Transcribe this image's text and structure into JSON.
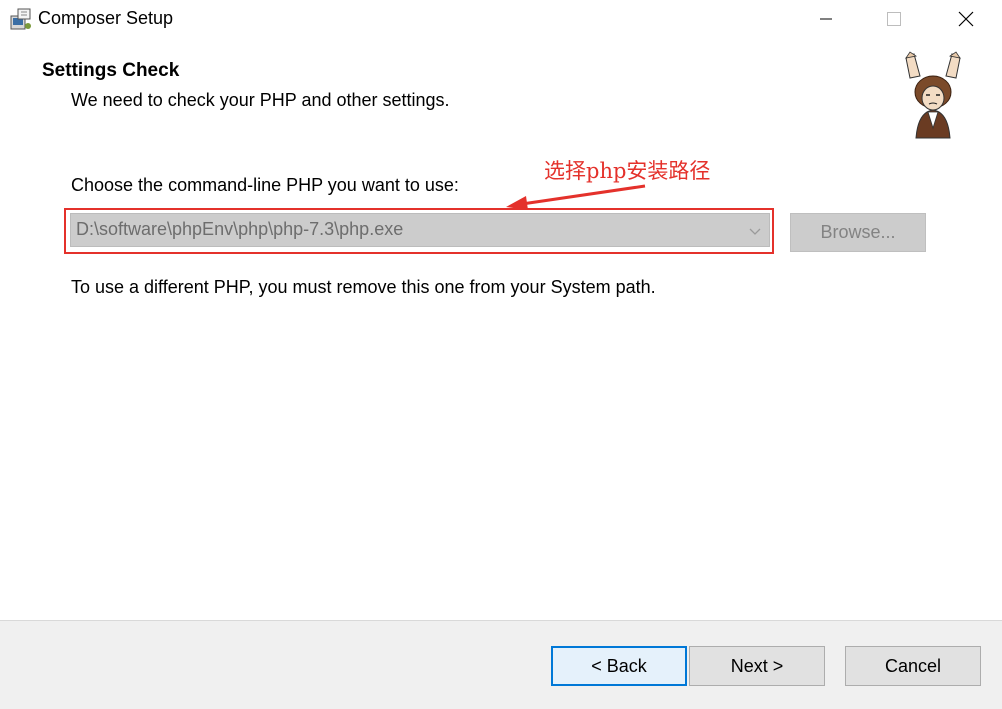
{
  "window": {
    "title": "Composer Setup"
  },
  "header": {
    "heading": "Settings Check",
    "subheading": "We need to check your PHP and other settings."
  },
  "body": {
    "prompt": "Choose the command-line PHP you want to use:",
    "php_select_value": "D:\\software\\phpEnv\\php\\php-7.3\\php.exe",
    "browse_label": "Browse...",
    "note": "To use a different PHP, you must remove this one from your System path.",
    "annotation_text": "选择php安装路径"
  },
  "footer": {
    "back_label": "< Back",
    "next_label": "Next >",
    "cancel_label": "Cancel"
  },
  "colors": {
    "annotation_red": "#e4312b",
    "focus_blue": "#0078d7",
    "disabled_bg": "#cccccc"
  },
  "icons": [
    "app-installer-icon",
    "minimize-icon",
    "maximize-icon",
    "close-icon",
    "composer-logo",
    "chevron-down-icon",
    "arrow-icon"
  ]
}
